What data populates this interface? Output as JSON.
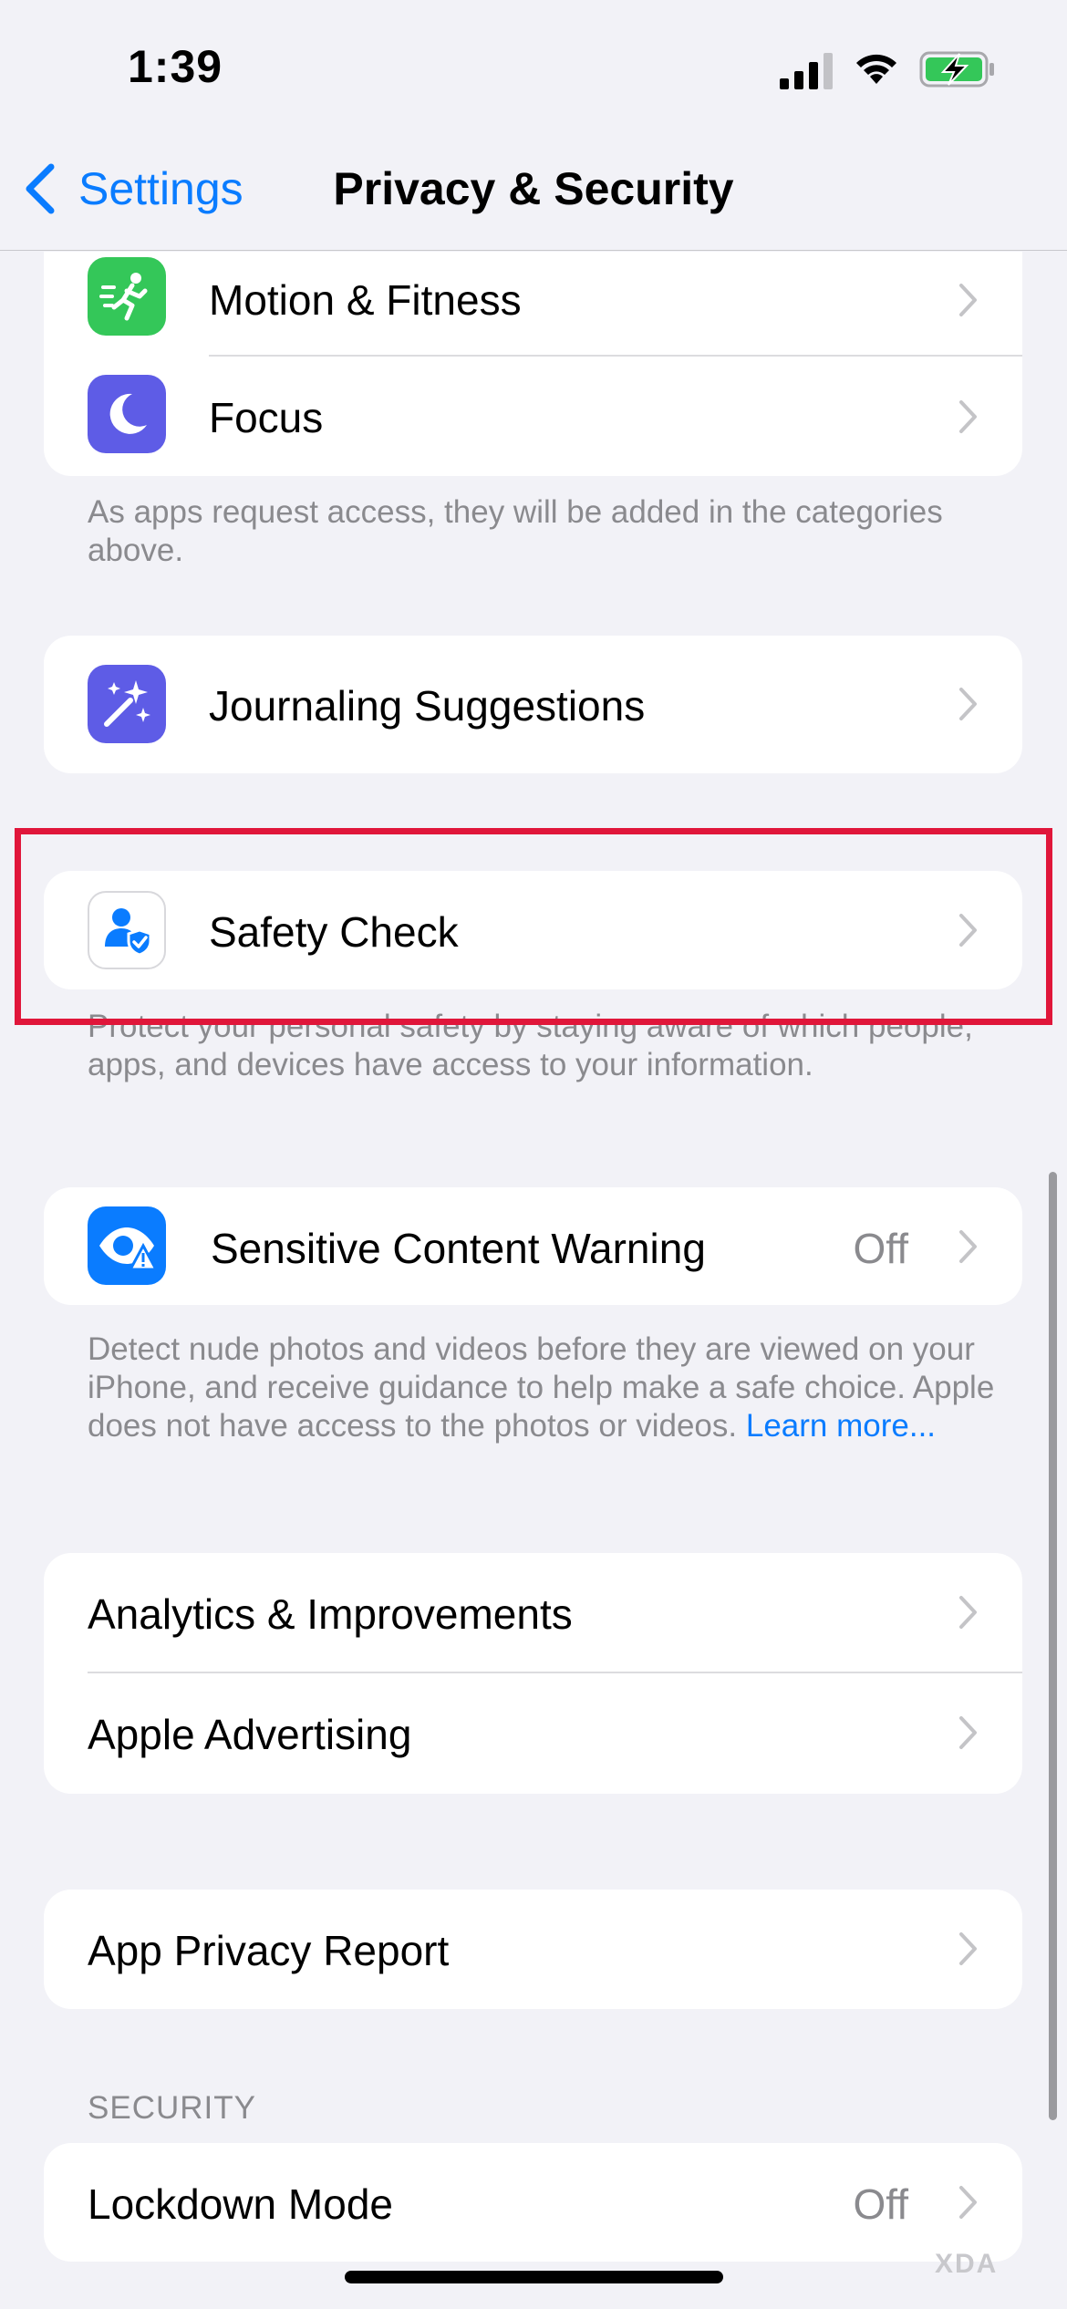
{
  "status_bar": {
    "time": "1:39"
  },
  "nav": {
    "back_label": "Settings",
    "title": "Privacy & Security"
  },
  "group_top": {
    "rows": [
      {
        "label": "Motion & Fitness",
        "icon": "running-figure-icon",
        "color": "#34c759"
      },
      {
        "label": "Focus",
        "icon": "moon-icon",
        "color": "#5e5ce6"
      }
    ],
    "footer": "As apps request access, they will be added in the categories above."
  },
  "journaling": {
    "label": "Journaling Suggestions",
    "icon": "sparkle-wand-icon",
    "color": "#5e5ce6"
  },
  "safety_check": {
    "label": "Safety Check",
    "icon": "person-shield-icon",
    "footer": "Protect your personal safety by staying aware of which people, apps, and devices have access to your information."
  },
  "sensitive": {
    "label": "Sensitive Content Warning",
    "value": "Off",
    "icon": "eye-warning-icon",
    "color": "#0a7cff",
    "footer": "Detect nude photos and videos before they are viewed on your iPhone, and receive guidance to help make a safe choice. Apple does not have access to the photos or videos.",
    "learn_more": "Learn more..."
  },
  "analytics_group": {
    "rows": [
      {
        "label": "Analytics & Improvements"
      },
      {
        "label": "Apple Advertising"
      }
    ]
  },
  "report": {
    "label": "App Privacy Report"
  },
  "security": {
    "header": "SECURITY",
    "rows": [
      {
        "label": "Lockdown Mode",
        "value": "Off"
      }
    ]
  },
  "watermark": "XDA",
  "highlight_color": "#e0163a"
}
